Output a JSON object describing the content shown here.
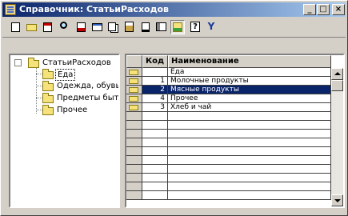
{
  "window": {
    "title": "Справочник: СтатьиРасходов",
    "min_symbol": "_",
    "max_symbol": "□",
    "close_symbol": "×"
  },
  "toolbar": {
    "buttons": [
      {
        "icon": "new-item-icon"
      },
      {
        "icon": "new-folder-icon"
      },
      {
        "icon": "edit-icon"
      },
      {
        "icon": "find-icon"
      },
      {
        "icon": "delete-icon"
      },
      {
        "icon": "move-icon"
      },
      {
        "icon": "copy-icon"
      },
      {
        "icon": "paste-icon"
      },
      {
        "icon": "document-icon"
      },
      {
        "icon": "view-icon"
      },
      {
        "icon": "hierarchy-icon",
        "pressed": true
      },
      {
        "icon": "help-icon",
        "glyph": "?"
      },
      {
        "icon": "filter-icon",
        "glyph": "Y"
      }
    ]
  },
  "tree": {
    "root": "СтатьиРасходов",
    "expander": "−",
    "items": [
      "Еда",
      "Одежда, обувь",
      "Предметы быта,",
      "Прочее"
    ],
    "selected_index": 0
  },
  "grid": {
    "columns": [
      "Код",
      "Наименование"
    ],
    "rows": [
      {
        "code": "",
        "name": "Еда",
        "marker": "folder-arrow"
      },
      {
        "code": "1",
        "name": "Молочные продукты",
        "marker": "folder"
      },
      {
        "code": "2",
        "name": "Мясные продукты",
        "marker": "folder",
        "selected": true
      },
      {
        "code": "4",
        "name": "Прочее",
        "marker": "folder"
      },
      {
        "code": "3",
        "name": "Хлеб и чай",
        "marker": "folder"
      }
    ],
    "empty_rows": 10
  },
  "colors": {
    "selection": "#0a246a",
    "face": "#d4d0c8",
    "folder": "#f5e27a"
  }
}
